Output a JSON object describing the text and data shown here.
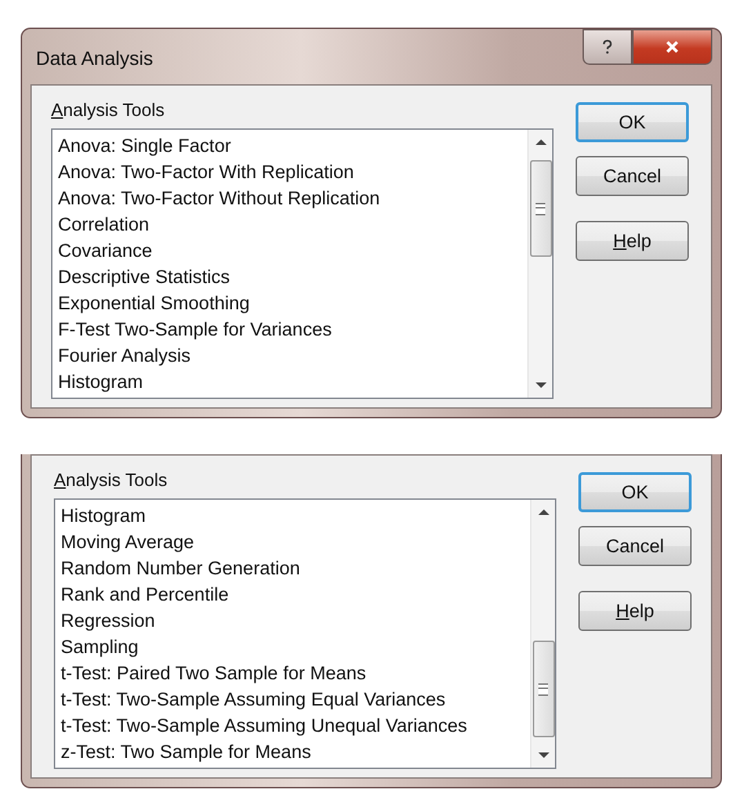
{
  "dialogs": [
    {
      "title": "Data Analysis",
      "list_label": "Analysis Tools",
      "items": [
        "Anova: Single Factor",
        "Anova: Two-Factor With Replication",
        "Anova: Two-Factor Without Replication",
        "Correlation",
        "Covariance",
        "Descriptive Statistics",
        "Exponential Smoothing",
        "F-Test Two-Sample for Variances",
        "Fourier Analysis",
        "Histogram"
      ],
      "buttons": [
        {
          "label": "OK",
          "default": true
        },
        {
          "label": "Cancel",
          "default": false
        },
        {
          "label": "Help",
          "default": false
        }
      ]
    },
    {
      "list_label": "Analysis Tools",
      "items": [
        "Histogram",
        "Moving Average",
        "Random Number Generation",
        "Rank and Percentile",
        "Regression",
        "Sampling",
        "t-Test: Paired Two Sample for Means",
        "t-Test: Two-Sample Assuming Equal Variances",
        "t-Test: Two-Sample Assuming Unequal Variances",
        "z-Test: Two Sample for Means"
      ],
      "buttons": [
        {
          "label": "OK",
          "default": true
        },
        {
          "label": "Cancel",
          "default": false
        },
        {
          "label": "Help",
          "default": false
        }
      ]
    }
  ]
}
